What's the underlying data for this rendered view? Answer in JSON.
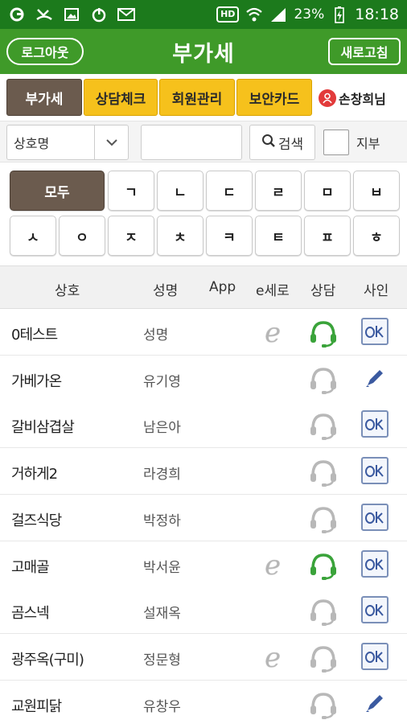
{
  "statusbar": {
    "hd": "HD",
    "battery": "23%",
    "time": "18:18"
  },
  "header": {
    "logout_label": "로그아웃",
    "title": "부가세",
    "refresh_label": "새로고침"
  },
  "tabs": [
    {
      "label": "부가세",
      "active": true
    },
    {
      "label": "상담체크",
      "active": false
    },
    {
      "label": "회원관리",
      "active": false
    },
    {
      "label": "보안카드",
      "active": false
    }
  ],
  "user": {
    "name": "손창희님"
  },
  "search": {
    "field_selected": "상호명",
    "input_value": "",
    "button_label": "검색",
    "checkbox_label": "지부",
    "checkbox_checked": false
  },
  "alphabet": {
    "row1": [
      "모두",
      "ㄱ",
      "ㄴ",
      "ㄷ",
      "ㄹ",
      "ㅁ",
      "ㅂ"
    ],
    "row2": [
      "ㅅ",
      "ㅇ",
      "ㅈ",
      "ㅊ",
      "ㅋ",
      "ㅌ",
      "ㅍ",
      "ㅎ"
    ],
    "active": "모두"
  },
  "table": {
    "headers": [
      "상호",
      "성명",
      "App",
      "e세로",
      "상담",
      "사인"
    ],
    "rows": [
      {
        "name": "0테스트",
        "rep": "성명",
        "e": true,
        "consult": "active",
        "sign": "ok"
      },
      {
        "name": "가베가온",
        "rep": "유기영",
        "e": false,
        "consult": "inactive",
        "sign": "pen"
      },
      {
        "name": "갈비삼겹살",
        "rep": "남은아",
        "e": false,
        "consult": "inactive",
        "sign": "ok"
      },
      {
        "name": "거하게2",
        "rep": "라경희",
        "e": false,
        "consult": "inactive",
        "sign": "ok"
      },
      {
        "name": "걸즈식당",
        "rep": "박정하",
        "e": false,
        "consult": "inactive",
        "sign": "ok"
      },
      {
        "name": "고매골",
        "rep": "박서윤",
        "e": true,
        "consult": "active",
        "sign": "ok"
      },
      {
        "name": "곰스넥",
        "rep": "설재옥",
        "e": false,
        "consult": "inactive",
        "sign": "ok"
      },
      {
        "name": "광주옥(구미)",
        "rep": "정문형",
        "e": true,
        "consult": "inactive",
        "sign": "ok"
      },
      {
        "name": "교원피닭",
        "rep": "유창우",
        "e": false,
        "consult": "inactive",
        "sign": "pen"
      }
    ]
  },
  "colors": {
    "status_bar": "#1c7a1c",
    "header": "#3f9a29",
    "tab_active": "#6b5b4e",
    "tab_yellow": "#f6c11c",
    "consult_active": "#3aa33a",
    "consult_inactive": "#b8b8b8",
    "sign_blue": "#3b5aa0"
  }
}
